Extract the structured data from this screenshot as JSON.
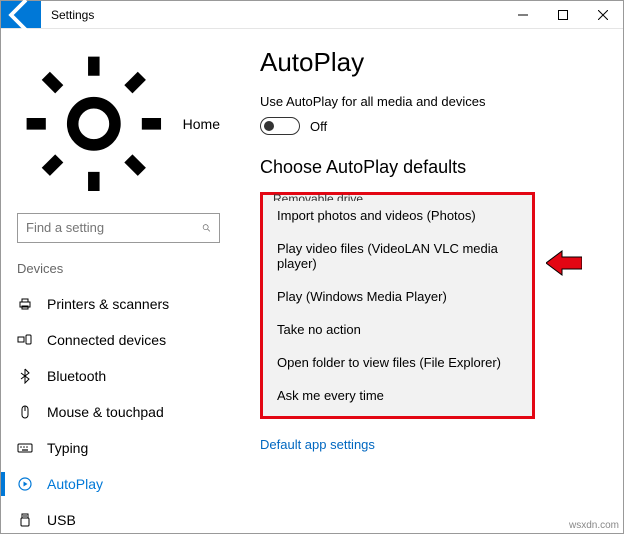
{
  "titlebar": {
    "title": "Settings"
  },
  "sidebar": {
    "home": "Home",
    "search_placeholder": "Find a setting",
    "section": "Devices",
    "items": [
      {
        "label": "Printers & scanners"
      },
      {
        "label": "Connected devices"
      },
      {
        "label": "Bluetooth"
      },
      {
        "label": "Mouse & touchpad"
      },
      {
        "label": "Typing"
      },
      {
        "label": "AutoPlay"
      },
      {
        "label": "USB"
      }
    ]
  },
  "main": {
    "title": "AutoPlay",
    "toggle_desc": "Use AutoPlay for all media and devices",
    "toggle_state": "Off",
    "section_title": "Choose AutoPlay defaults",
    "dropdown_label": "Removable drive",
    "options": [
      "Import photos and videos (Photos)",
      "Play video files (VideoLAN VLC media player)",
      "Play (Windows Media Player)",
      "Take no action",
      "Open folder to view files (File Explorer)",
      "Ask me every time"
    ],
    "link": "Default app settings"
  },
  "footer": "wsxdn.com"
}
